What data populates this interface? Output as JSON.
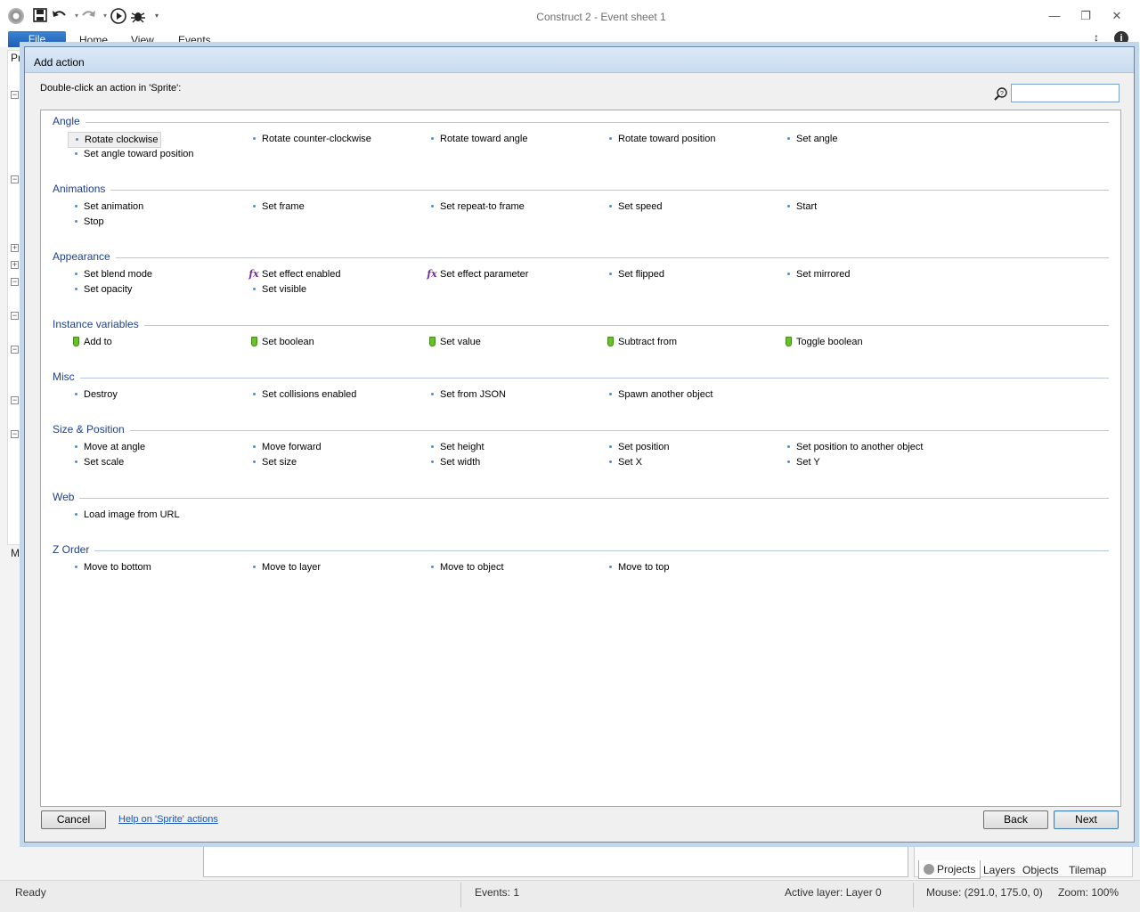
{
  "window": {
    "title": "Construct 2 - Event sheet 1",
    "controls": {
      "minimize": "—",
      "restore": "❐",
      "close": "✕"
    }
  },
  "quick_access": {
    "icons": [
      "gear-icon",
      "save-icon",
      "undo-icon",
      "redo-icon",
      "run-icon",
      "debug-icon",
      "customize-icon"
    ]
  },
  "ribbon": {
    "file": "File",
    "tabs": [
      "Home",
      "View",
      "Events"
    ],
    "minimize_glyph": "↕",
    "info_glyph": "i"
  },
  "left_panel": {
    "top_text": "Pro",
    "bottom_text": "Mo"
  },
  "dialog": {
    "title": "Add action",
    "instruction": "Double-click an action in 'Sprite':",
    "search": {
      "value": "",
      "placeholder": ""
    },
    "categories": [
      {
        "title": "Angle",
        "items": [
          {
            "label": "Rotate clockwise",
            "icon": "dot",
            "selected": true
          },
          {
            "label": "Rotate counter-clockwise",
            "icon": "dot"
          },
          {
            "label": "Rotate toward angle",
            "icon": "dot"
          },
          {
            "label": "Rotate toward position",
            "icon": "dot"
          },
          {
            "label": "Set angle",
            "icon": "dot"
          },
          {
            "label": "Set angle toward position",
            "icon": "dot"
          }
        ]
      },
      {
        "title": "Animations",
        "items": [
          {
            "label": "Set animation",
            "icon": "dot"
          },
          {
            "label": "Set frame",
            "icon": "dot"
          },
          {
            "label": "Set repeat-to frame",
            "icon": "dot"
          },
          {
            "label": "Set speed",
            "icon": "dot"
          },
          {
            "label": "Start",
            "icon": "dot"
          },
          {
            "label": "Stop",
            "icon": "dot"
          }
        ]
      },
      {
        "title": "Appearance",
        "items": [
          {
            "label": "Set blend mode",
            "icon": "dot"
          },
          {
            "label": "Set effect enabled",
            "icon": "fx"
          },
          {
            "label": "Set effect parameter",
            "icon": "fx"
          },
          {
            "label": "Set flipped",
            "icon": "dot"
          },
          {
            "label": "Set mirrored",
            "icon": "dot"
          },
          {
            "label": "Set opacity",
            "icon": "dot"
          },
          {
            "label": "Set visible",
            "icon": "dot"
          }
        ]
      },
      {
        "title": "Instance variables",
        "items": [
          {
            "label": "Add to",
            "icon": "tag"
          },
          {
            "label": "Set boolean",
            "icon": "tag"
          },
          {
            "label": "Set value",
            "icon": "tag"
          },
          {
            "label": "Subtract from",
            "icon": "tag"
          },
          {
            "label": "Toggle boolean",
            "icon": "tag"
          }
        ]
      },
      {
        "title": "Misc",
        "items": [
          {
            "label": "Destroy",
            "icon": "dot"
          },
          {
            "label": "Set collisions enabled",
            "icon": "dot"
          },
          {
            "label": "Set from JSON",
            "icon": "dot"
          },
          {
            "label": "Spawn another object",
            "icon": "dot"
          }
        ]
      },
      {
        "title": "Size & Position",
        "items": [
          {
            "label": "Move at angle",
            "icon": "dot"
          },
          {
            "label": "Move forward",
            "icon": "dot"
          },
          {
            "label": "Set height",
            "icon": "dot"
          },
          {
            "label": "Set position",
            "icon": "dot"
          },
          {
            "label": "Set position to another object",
            "icon": "dot"
          },
          {
            "label": "Set scale",
            "icon": "dot"
          },
          {
            "label": "Set size",
            "icon": "dot"
          },
          {
            "label": "Set width",
            "icon": "dot"
          },
          {
            "label": "Set X",
            "icon": "dot"
          },
          {
            "label": "Set Y",
            "icon": "dot"
          }
        ]
      },
      {
        "title": "Web",
        "items": [
          {
            "label": "Load image from URL",
            "icon": "dot"
          }
        ]
      },
      {
        "title": "Z Order",
        "items": [
          {
            "label": "Move to bottom",
            "icon": "dot"
          },
          {
            "label": "Move to layer",
            "icon": "dot"
          },
          {
            "label": "Move to object",
            "icon": "dot"
          },
          {
            "label": "Move to top",
            "icon": "dot"
          }
        ]
      }
    ],
    "buttons": {
      "cancel": "Cancel",
      "help": "Help on 'Sprite' actions",
      "back": "Back",
      "next": "Next"
    }
  },
  "project_bar": {
    "tabs": [
      "Projects",
      "Layers",
      "Objects",
      "Tilemap"
    ]
  },
  "status_bar": {
    "ready": "Ready",
    "events": "Events: 1",
    "active_layer": "Active layer: Layer 0",
    "mouse": "Mouse: (291.0, 175.0, 0)",
    "zoom": "Zoom: 100%"
  },
  "colors": {
    "category_title": "#1e3f8c",
    "file_tab": "#2a6fc4",
    "link": "#1a56b6",
    "dialog_header": "#c9dcf0"
  }
}
